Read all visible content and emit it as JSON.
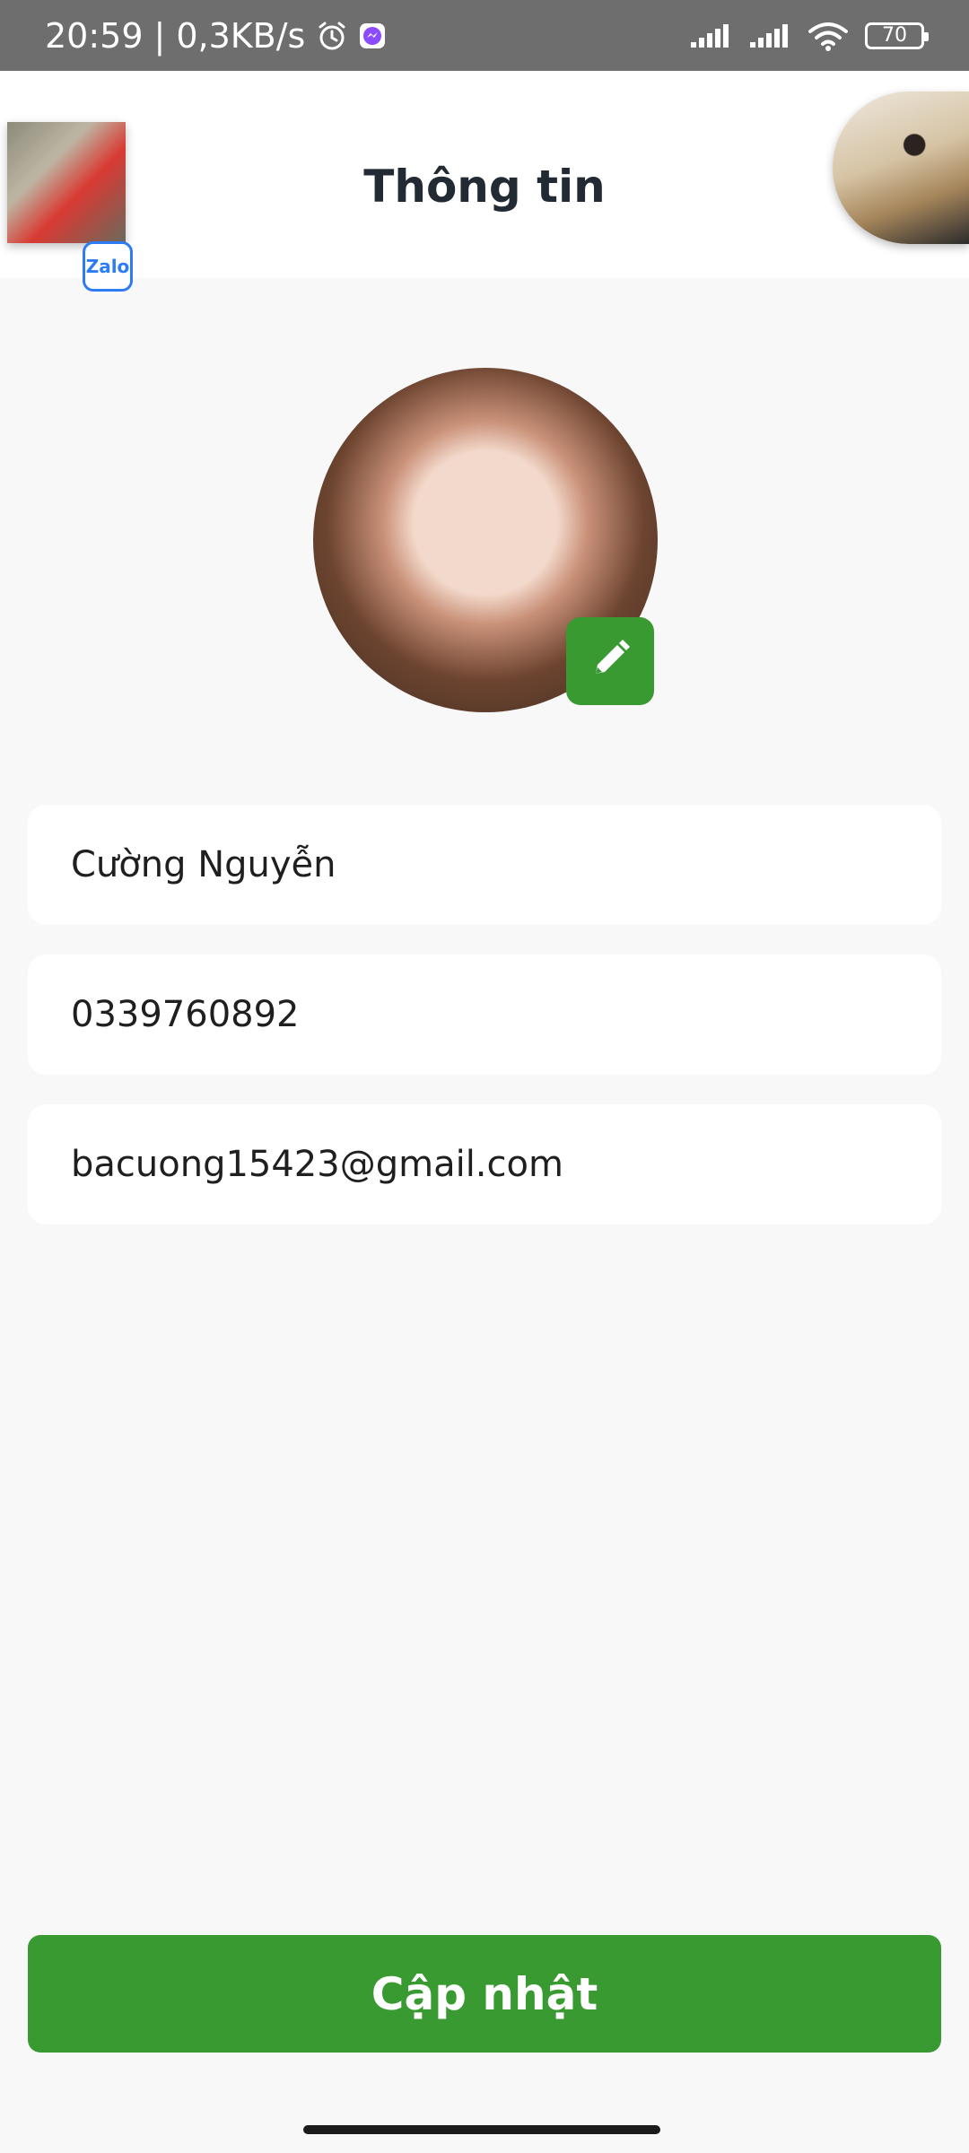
{
  "status_bar": {
    "time": "20:59",
    "separator": "|",
    "speed": "0,3KB/s",
    "battery": "70",
    "icons": [
      "alarm-icon",
      "messenger-icon",
      "signal-icon",
      "signal-icon",
      "wifi-icon",
      "battery-icon"
    ]
  },
  "header": {
    "title": "Thông tin",
    "left_bubble_badge": "Zalo"
  },
  "profile": {
    "name": "Cường Nguyễn",
    "phone": "0339760892",
    "email": "bacuong15423@gmail.com"
  },
  "actions": {
    "update_label": "Cập nhật"
  },
  "colors": {
    "accent_green": "#3a9a32",
    "status_bar": "#6e6e6e",
    "background": "#f8f8f8",
    "title_text": "#222b33"
  }
}
